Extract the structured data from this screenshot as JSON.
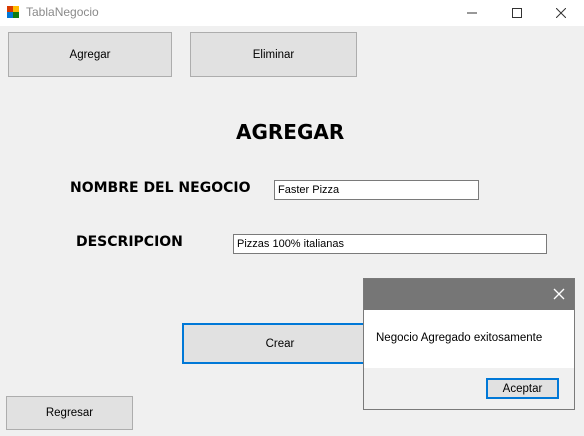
{
  "window": {
    "title": "TablaNegocio",
    "icons": {
      "app": "app-form-icon",
      "minimize": "minimize-icon",
      "maximize": "maximize-icon",
      "close": "close-icon"
    }
  },
  "toolbar": {
    "agregar_label": "Agregar",
    "eliminar_label": "Eliminar"
  },
  "form": {
    "heading": "AGREGAR",
    "nombre_label": "NOMBRE DEL NEGOCIO",
    "nombre_value": "Faster Pizza",
    "descripcion_label": "DESCRIPCION",
    "descripcion_value": "Pizzas 100% italianas",
    "crear_label": "Crear",
    "regresar_label": "Regresar"
  },
  "dialog": {
    "message": "Negocio Agregado exitosamente",
    "ok_label": "Aceptar",
    "header_color": "#767676",
    "accent_color": "#0078d7"
  }
}
